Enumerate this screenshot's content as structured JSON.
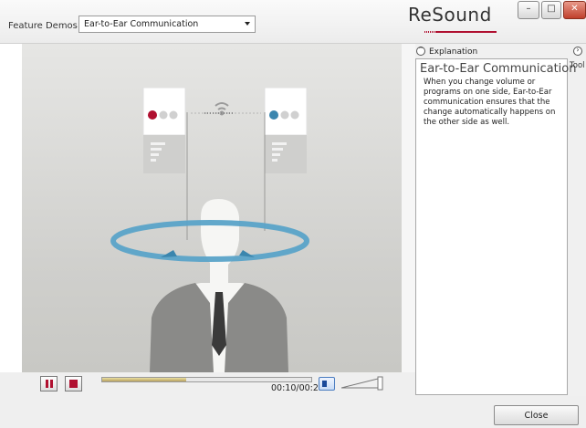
{
  "header": {
    "feature_label": "Feature Demos",
    "selected_demo": "Ear-to-Ear Communication",
    "brand": "ReSound"
  },
  "window_controls": {
    "minimize": "–",
    "maximize": "□",
    "close": "✕"
  },
  "player": {
    "time": "00:10/00:25",
    "progress": 0.4,
    "volume": 0.75,
    "icons": {
      "pause": "pause-icon",
      "stop": "stop-icon",
      "speaker": "speaker-icon"
    }
  },
  "explanation": {
    "toggle_label": "Explanation",
    "title": "Ear-to-Ear Communication",
    "body": "When you change volume or programs on one side, Ear-to-Ear communication ensures that the change automatically happens on the other side as well."
  },
  "tools": {
    "label": "Tool"
  },
  "footer": {
    "close_label": "Close"
  },
  "colors": {
    "accent": "#b01030",
    "ring": "#5aa3c8",
    "ring_dark": "#3b86ae"
  }
}
